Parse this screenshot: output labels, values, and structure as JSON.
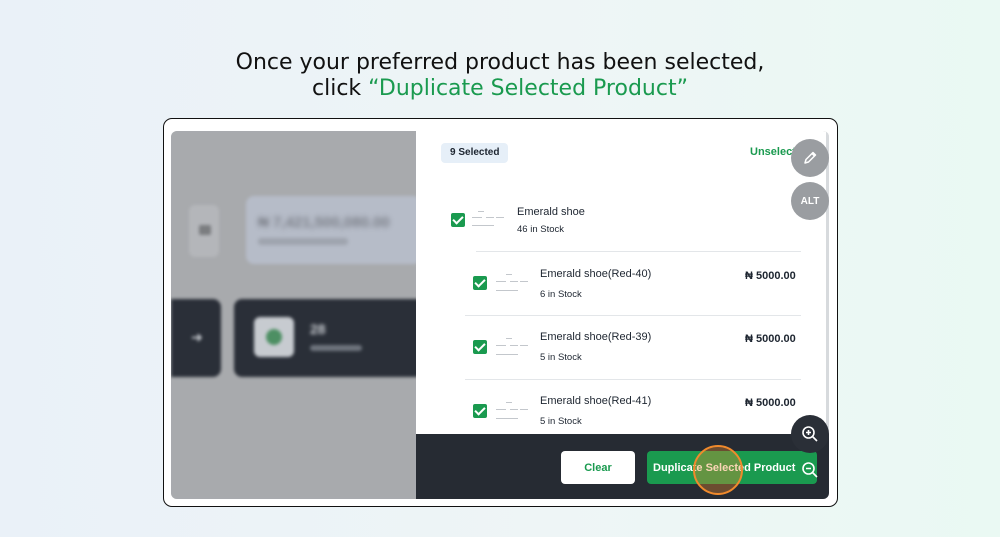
{
  "heading": {
    "line1": "Once your preferred product has been selected,",
    "line2_prefix": "click ",
    "line2_accent": "“Duplicate Selected Product”"
  },
  "background": {
    "amount": "₦ 7,421,500,080.00",
    "orders_count": "28"
  },
  "panel": {
    "selected_badge": "9 Selected",
    "unselect_label": "Unselect",
    "products": [
      {
        "name": "Emerald shoe",
        "stock": "46 in Stock",
        "price": ""
      },
      {
        "name": "Emerald shoe(Red-40)",
        "stock": "6 in Stock",
        "price": "₦ 5000.00"
      },
      {
        "name": "Emerald shoe(Red-39)",
        "stock": "5 in Stock",
        "price": "₦ 5000.00"
      },
      {
        "name": "Emerald shoe(Red-41)",
        "stock": "5 in Stock",
        "price": "₦ 5000.00"
      }
    ],
    "clear_label": "Clear",
    "duplicate_label": "Duplicate Selected Product"
  },
  "tools": {
    "alt_label": "ALT"
  },
  "icons": {
    "edit": "pencil-icon",
    "zoom_in": "zoom-in-icon",
    "zoom_out": "zoom-out-icon",
    "arrow": "arrow-right-icon"
  },
  "colors": {
    "accent": "#1a9a4f",
    "footer": "#262b33",
    "click_indicator": "#f08a2c"
  }
}
